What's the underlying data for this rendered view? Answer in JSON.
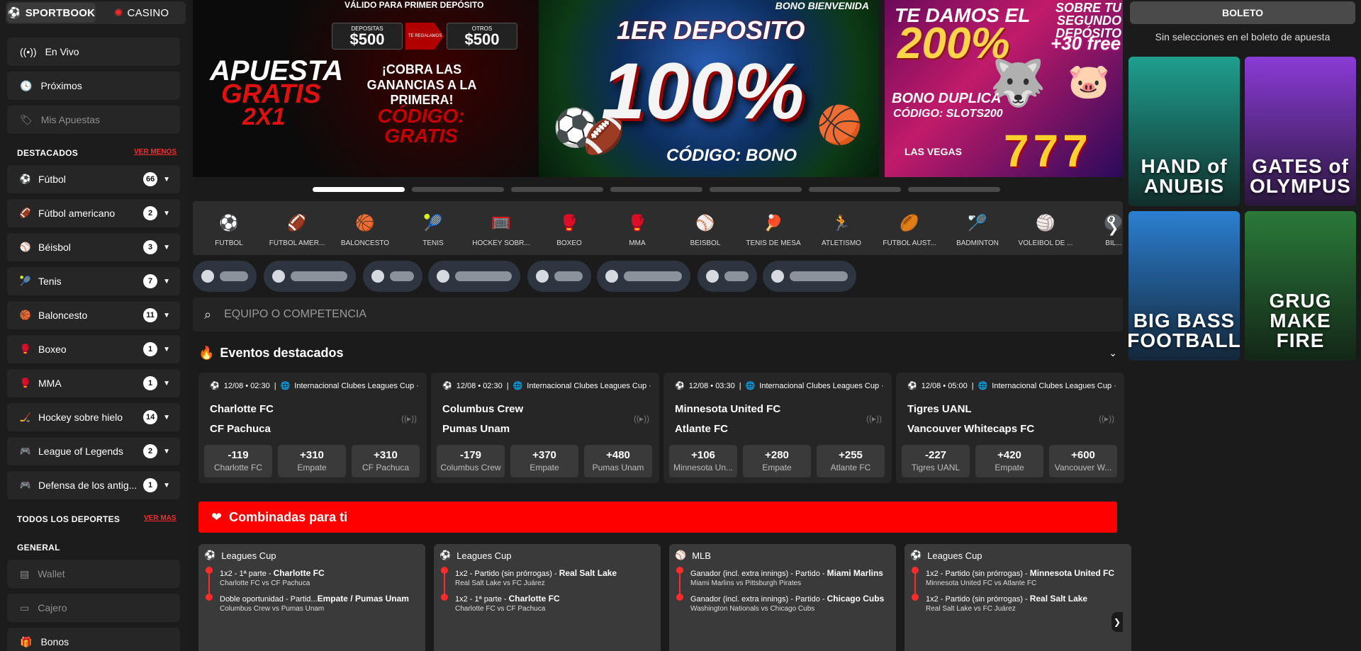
{
  "nav": {
    "sportsbook": "SPORTBOOK",
    "casino": "CASINO",
    "live": "En Vivo",
    "upcoming": "Próximos",
    "my_bets": "Mis Apuestas"
  },
  "featured_section": {
    "title": "DESTACADOS",
    "toggle": "VER MENOS",
    "sports": [
      {
        "label": "Fútbol",
        "count": "66",
        "icon": "soccer-ball-icon"
      },
      {
        "label": "Fútbol americano",
        "count": "2",
        "icon": "american-football-icon"
      },
      {
        "label": "Béisbol",
        "count": "3",
        "icon": "baseball-icon"
      },
      {
        "label": "Tenis",
        "count": "7",
        "icon": "tennis-ball-icon"
      },
      {
        "label": "Baloncesto",
        "count": "11",
        "icon": "basketball-icon"
      },
      {
        "label": "Boxeo",
        "count": "1",
        "icon": "boxing-glove-icon"
      },
      {
        "label": "MMA",
        "count": "1",
        "icon": "mma-glove-icon"
      },
      {
        "label": "Hockey sobre hielo",
        "count": "14",
        "icon": "hockey-icon"
      },
      {
        "label": "League of Legends",
        "count": "2",
        "icon": "gamepad-icon"
      },
      {
        "label": "Defensa de los antig...",
        "count": "1",
        "icon": "gamepad-icon"
      }
    ]
  },
  "all_sports": {
    "title": "TODOS LOS DEPORTES",
    "toggle": "VER MAS"
  },
  "general": {
    "title": "GENERAL",
    "items": [
      {
        "label": "Wallet",
        "icon": "wallet-icon"
      },
      {
        "label": "Cajero",
        "icon": "card-icon"
      },
      {
        "label": "Bonos",
        "icon": "gift-icon"
      }
    ]
  },
  "banners": [
    {
      "headline": "VÁLIDO PARA PRIMER DEPÓSITO",
      "dep_label": "DEPOSITAS",
      "dep_amount": "$500",
      "arrow_label": "TE REGALAMOS",
      "gift_label": "OTROS",
      "gift_amount": "$500",
      "promo1": "APUESTA",
      "promo2": "GRATIS",
      "promo3": "2X1",
      "claim": "¡COBRA LAS GANANCIAS A LA PRIMERA!",
      "code": "CÓDIGO: GRATIS"
    },
    {
      "tag": "BONO BIENVENIDA",
      "title": "1ER DEPOSITO",
      "big": "100%",
      "code": "CÓDIGO: BONO"
    },
    {
      "line1": "TE DAMOS EL",
      "big": "200%",
      "side": "SOBRE TU SEGUNDO DEPÓSITO",
      "extra": "+30 free",
      "bono": "BONO DUPLICA",
      "code": "CÓDIGO: SLOTS200",
      "brand": "LAS VEGAS",
      "slots": "777"
    }
  ],
  "carousel": {
    "active_index": 0,
    "count": 7
  },
  "sports_strip": [
    {
      "label": "FÚTBOL",
      "glyph": "⚽",
      "color": "#ffffff"
    },
    {
      "label": "FÚTBOL AMER...",
      "glyph": "🏈",
      "color": "#8b4a2b"
    },
    {
      "label": "BALONCESTO",
      "glyph": "🏀",
      "color": "#f08a24"
    },
    {
      "label": "TENIS",
      "glyph": "🎾",
      "color": "#cde023"
    },
    {
      "label": "HOCKEY SOBR...",
      "glyph": "🥅",
      "color": "#e63a3a"
    },
    {
      "label": "BOXEO",
      "glyph": "🥊",
      "color": "#e63a3a"
    },
    {
      "label": "MMA",
      "glyph": "🥊",
      "color": "#e63a3a"
    },
    {
      "label": "BÉISBOL",
      "glyph": "⚾",
      "color": "#f2f2f2"
    },
    {
      "label": "TENIS DE MESA",
      "glyph": "🏓",
      "color": "#e63a3a"
    },
    {
      "label": "ATLETISMO",
      "glyph": "🏃",
      "color": "#f2c20f"
    },
    {
      "label": "FÚTBOL AUST...",
      "glyph": "🏉",
      "color": "#8b4a2b"
    },
    {
      "label": "BÁDMINTON",
      "glyph": "🏸",
      "color": "#f2f2f2"
    },
    {
      "label": "VOLEIBOL DE ...",
      "glyph": "🏐",
      "color": "#f2f2f2"
    },
    {
      "label": "BIL...",
      "glyph": "🎱",
      "color": "#777777"
    }
  ],
  "search": {
    "placeholder": "EQUIPO O COMPETENCIA"
  },
  "featured_events": {
    "title": "Eventos destacados",
    "events": [
      {
        "datetime": "12/08 • 02:30",
        "league": "Internacional Clubes Leagues Cup ·",
        "home": "Charlotte FC",
        "away": "CF Pachuca",
        "odds": [
          {
            "value": "-119",
            "name": "Charlotte FC"
          },
          {
            "value": "+310",
            "name": "Empate"
          },
          {
            "value": "+310",
            "name": "CF Pachuca"
          }
        ]
      },
      {
        "datetime": "12/08 • 02:30",
        "league": "Internacional Clubes Leagues Cup ·",
        "home": "Columbus Crew",
        "away": "Pumas Unam",
        "odds": [
          {
            "value": "-179",
            "name": "Columbus Crew"
          },
          {
            "value": "+370",
            "name": "Empate"
          },
          {
            "value": "+480",
            "name": "Pumas Unam"
          }
        ]
      },
      {
        "datetime": "12/08 • 03:30",
        "league": "Internacional Clubes Leagues Cup ·",
        "home": "Minnesota United FC",
        "away": "Atlante FC",
        "odds": [
          {
            "value": "+106",
            "name": "Minnesota Un..."
          },
          {
            "value": "+280",
            "name": "Empate"
          },
          {
            "value": "+255",
            "name": "Atlante FC"
          }
        ]
      },
      {
        "datetime": "12/08 • 05:00",
        "league": "Internacional Clubes Leagues Cup ·",
        "home": "Tigres UANL",
        "away": "Vancouver Whitecaps FC",
        "odds": [
          {
            "value": "-227",
            "name": "Tigres UANL"
          },
          {
            "value": "+420",
            "name": "Empate"
          },
          {
            "value": "+600",
            "name": "Vancouver W..."
          }
        ]
      }
    ]
  },
  "combos": {
    "title": "Combinadas para ti",
    "cards": [
      {
        "league": "Leagues Cup",
        "icon": "soccer-ball-icon",
        "legs": [
          {
            "market": "1x2 - 1ª parte - ",
            "pick": "Charlotte FC",
            "match": "Charlotte FC vs CF Pachuca"
          },
          {
            "market": "Doble oportunidad - Partid...",
            "pick": "Empate / Pumas Unam",
            "match": "Columbus Crew vs Pumas Unam"
          }
        ]
      },
      {
        "league": "Leagues Cup",
        "icon": "soccer-ball-icon",
        "legs": [
          {
            "market": "1x2 - Partido (sin prórrogas) - ",
            "pick": "Real Salt Lake",
            "match": "Real Salt Lake vs FC Juárez"
          },
          {
            "market": "1x2 - 1ª parte - ",
            "pick": "Charlotte FC",
            "match": "Charlotte FC vs CF Pachuca"
          }
        ]
      },
      {
        "league": "MLB",
        "icon": "baseball-icon",
        "legs": [
          {
            "market": "Ganador (incl. extra innings) - Partido - ",
            "pick": "Miami Marlins",
            "match": "Miami Marlins vs Pittsburgh Pirates"
          },
          {
            "market": "Ganador (incl. extra innings) - Partido - ",
            "pick": "Chicago Cubs",
            "match": "Washington Nationals vs Chicago Cubs"
          }
        ]
      },
      {
        "league": "Leagues Cup",
        "icon": "soccer-ball-icon",
        "legs": [
          {
            "market": "1x2 - Partido (sin prórrogas) - ",
            "pick": "Minnesota United FC",
            "match": "Minnesota United FC vs Atlante FC"
          },
          {
            "market": "1x2 - Partido (sin prórrogas) - ",
            "pick": "Real Salt Lake",
            "match": "Real Salt Lake vs FC Juárez"
          }
        ]
      }
    ]
  },
  "betslip": {
    "title": "BOLETO",
    "empty": "Sin selecciones en el boleto de apuesta"
  },
  "casino_games": [
    {
      "title": "HAND of ANUBIS",
      "bg": "#1f9f8f"
    },
    {
      "title": "GATES of OLYMPUS",
      "bg": "#8a3bd6"
    },
    {
      "title": "BIG BASS FOOTBALL",
      "bg": "#2b7fd0"
    },
    {
      "title": "GRUG MAKE FIRE",
      "bg": "#2a7a3a"
    }
  ],
  "colors": {
    "accent": "#ff0000",
    "panel": "#262626",
    "bg": "#1b1b1b"
  }
}
